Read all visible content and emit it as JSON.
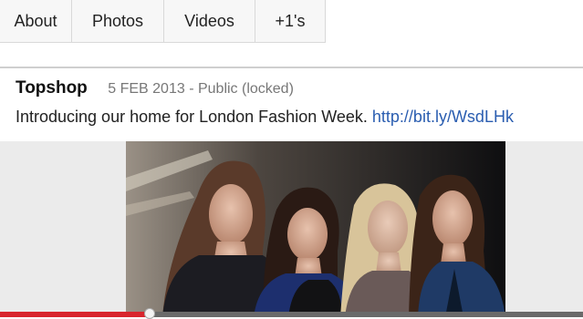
{
  "tabs": [
    {
      "label": "About"
    },
    {
      "label": "Photos"
    },
    {
      "label": "Videos"
    },
    {
      "label": "+1's"
    }
  ],
  "post": {
    "author": "Topshop",
    "meta": "5 FEB 2013 - Public (locked)",
    "text": "Introducing our home for London Fashion Week. ",
    "link": "http://bit.ly/WsdLHk"
  },
  "video_progress": {
    "fraction": 0.26
  },
  "colors": {
    "link": "#2a5db0",
    "progress": "#d8262e"
  },
  "photo": {
    "subject": "four-models-photo"
  }
}
